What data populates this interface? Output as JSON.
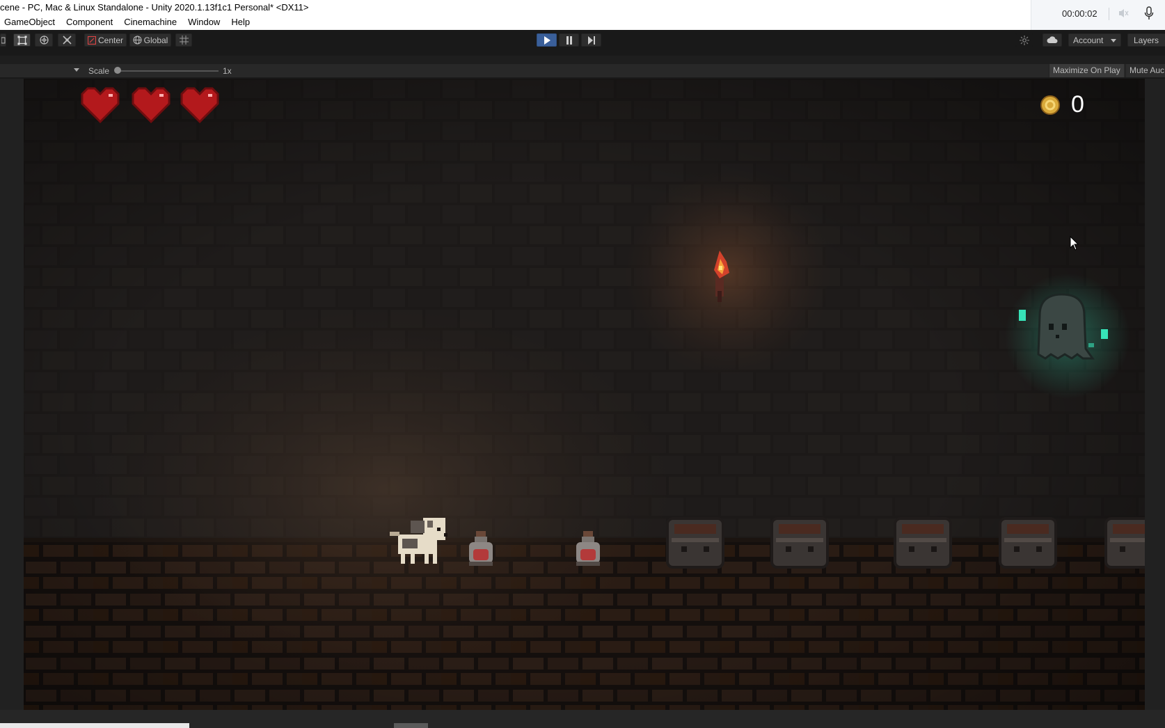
{
  "window": {
    "title": "cene - PC, Mac & Linux Standalone - Unity 2020.1.13f1c1 Personal* <DX11>",
    "menus": [
      "GameObject",
      "Component",
      "Cinemachine",
      "Window",
      "Help"
    ]
  },
  "recorder": {
    "time": "00:00:02",
    "icons": [
      "mute-speaker-icon",
      "microphone-icon"
    ]
  },
  "toolbar": {
    "pivot_label": "Center",
    "space_label": "Global",
    "account_label": "Account",
    "layers_label": "Layers",
    "play_state": "playing",
    "icons": [
      "rect-tool-icon",
      "rotate-tool-icon",
      "transform-tool-icon",
      "grid-snap-icon",
      "play-icon",
      "pause-icon",
      "step-icon",
      "collab-icon",
      "cloud-icon"
    ]
  },
  "game_view": {
    "scale_label": "Scale",
    "scale_value": "1x",
    "maximize_label": "Maximize On Play",
    "mute_label": "Mute Auc"
  },
  "hud": {
    "hearts": 3,
    "coins": "0",
    "colors": {
      "heart": "#b3191c",
      "coin": "#d9a93a",
      "ghost_glow": "#37e3b8",
      "torch": "#e3572b"
    }
  },
  "scene": {
    "entities": [
      "dog-player",
      "health-potion",
      "health-potion",
      "treasure-chest",
      "treasure-chest",
      "treasure-chest",
      "treasure-chest",
      "treasure-chest",
      "wall-torch",
      "ghost-enemy"
    ]
  }
}
